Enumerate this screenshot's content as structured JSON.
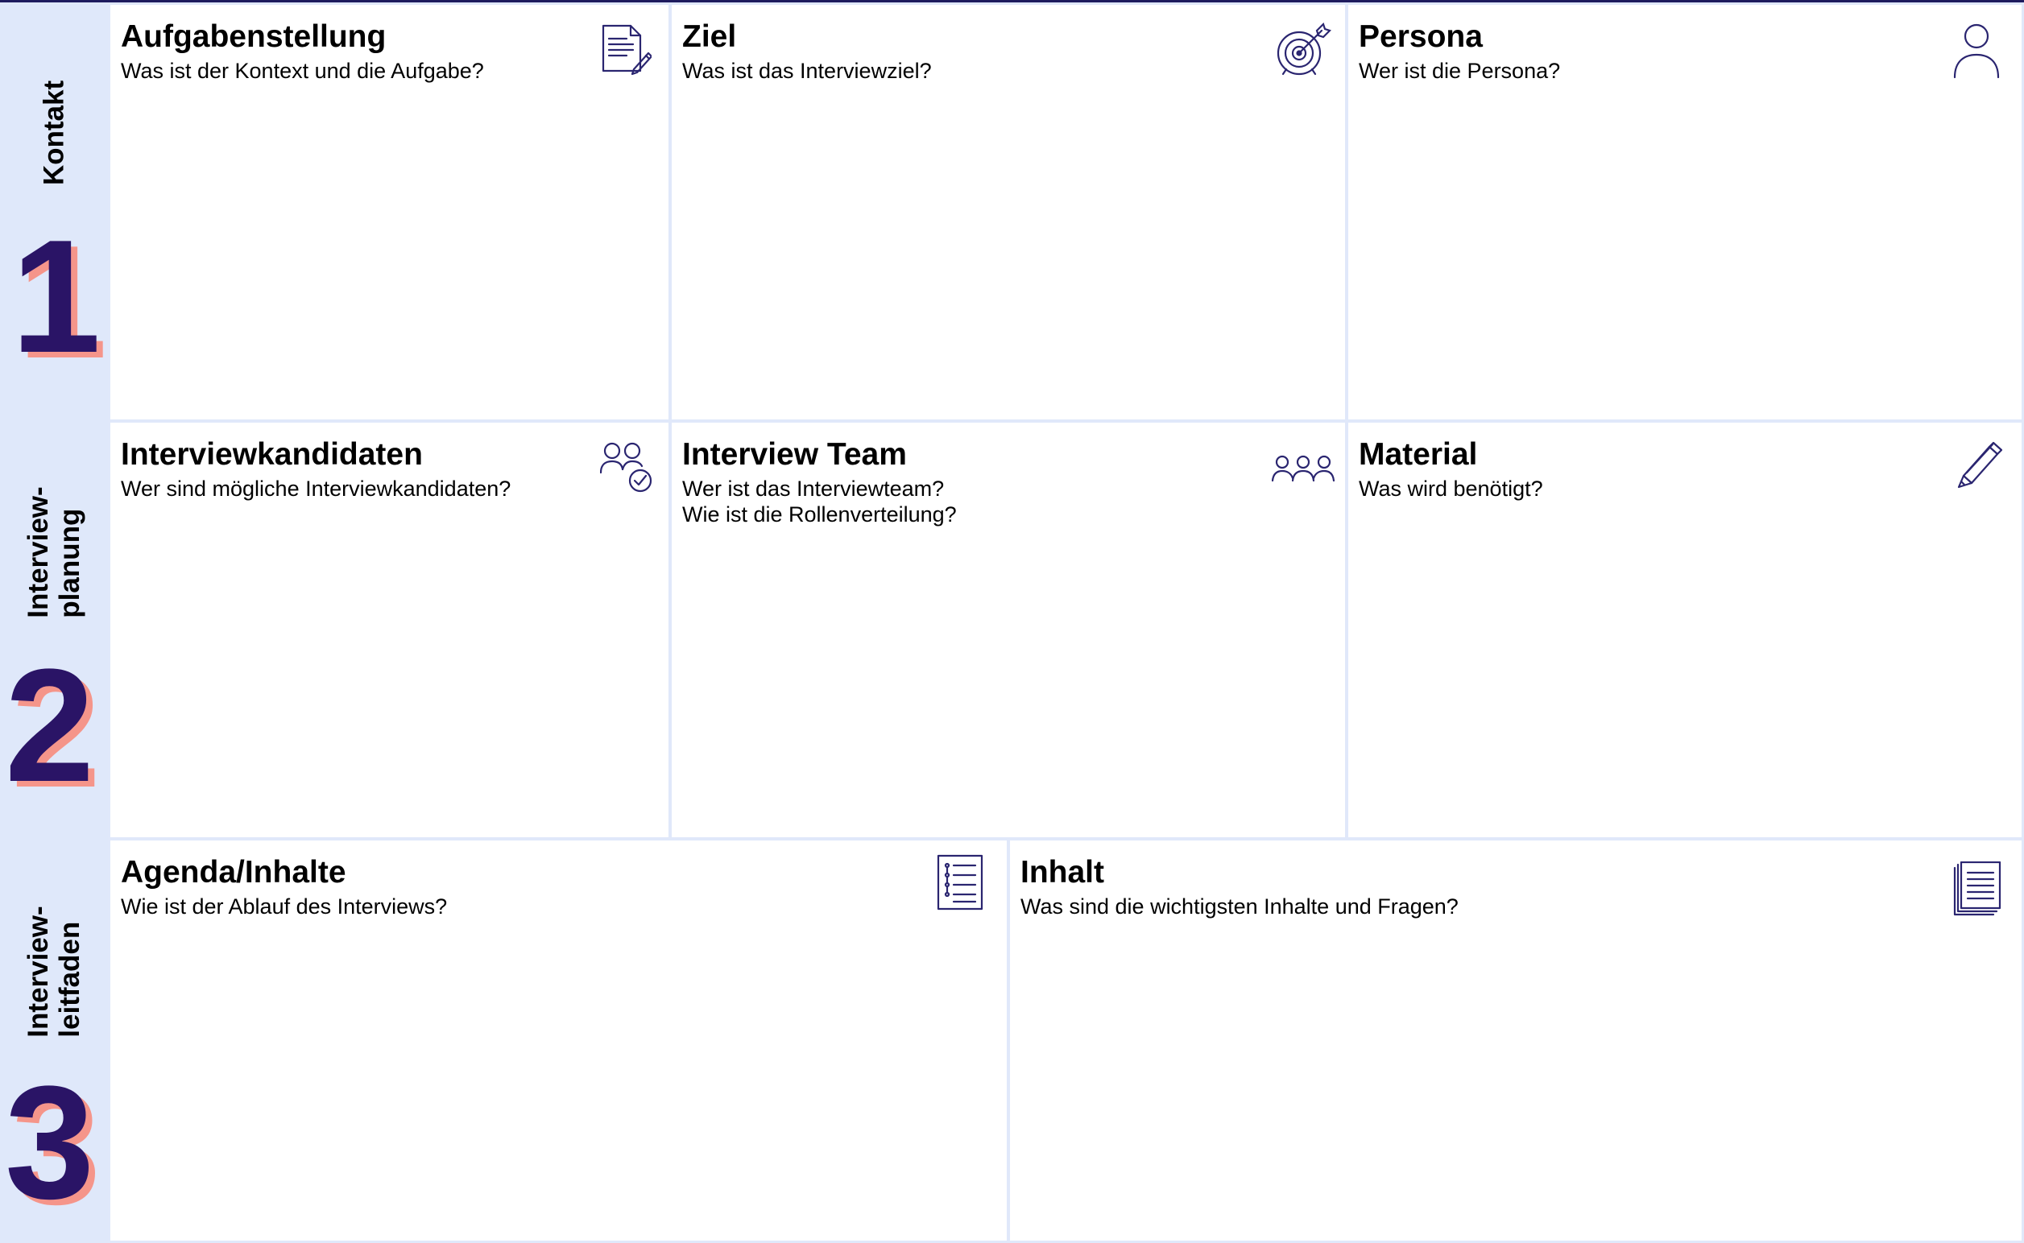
{
  "colors": {
    "sidebar_bg": "#dfe8fa",
    "number_fill": "#2a1466",
    "number_shadow": "#f5958a",
    "cell_border": "#e0e8fa",
    "icon_stroke": "#2a2570",
    "top_line": "#1e1b5e"
  },
  "sidebar": {
    "sections": [
      {
        "number": "1",
        "label_lines": [
          "Kontakt"
        ]
      },
      {
        "number": "2",
        "label_lines": [
          "Interview-",
          "planung"
        ]
      },
      {
        "number": "3",
        "label_lines": [
          "Interview-",
          "leitfaden"
        ]
      }
    ]
  },
  "cells": {
    "aufgabenstellung": {
      "title": "Aufgabenstellung",
      "question_lines": [
        "Was ist der Kontext und die Aufgabe?"
      ],
      "icon": "document-edit-icon"
    },
    "ziel": {
      "title": "Ziel",
      "question_lines": [
        "Was ist das Interviewziel?"
      ],
      "icon": "target-icon"
    },
    "persona": {
      "title": "Persona",
      "question_lines": [
        "Wer ist die Persona?"
      ],
      "icon": "user-icon"
    },
    "interviewkandidaten": {
      "title": "Interviewkandidaten",
      "question_lines": [
        "Wer sind mögliche Interviewkandidaten?"
      ],
      "icon": "users-check-icon"
    },
    "interview_team": {
      "title": "Interview Team",
      "question_lines": [
        "Wer ist das Interviewteam?",
        "Wie ist die Rollenverteilung?"
      ],
      "icon": "team-icon"
    },
    "material": {
      "title": "Material",
      "question_lines": [
        "Was wird benötigt?"
      ],
      "icon": "pencil-icon"
    },
    "agenda": {
      "title": "Agenda/Inhalte",
      "question_lines": [
        "Wie ist der Ablauf des Interviews?"
      ],
      "icon": "checklist-icon"
    },
    "inhalt": {
      "title": "Inhalt",
      "question_lines": [
        "Was sind die wichtigsten Inhalte und Fragen?"
      ],
      "icon": "documents-stack-icon"
    }
  }
}
